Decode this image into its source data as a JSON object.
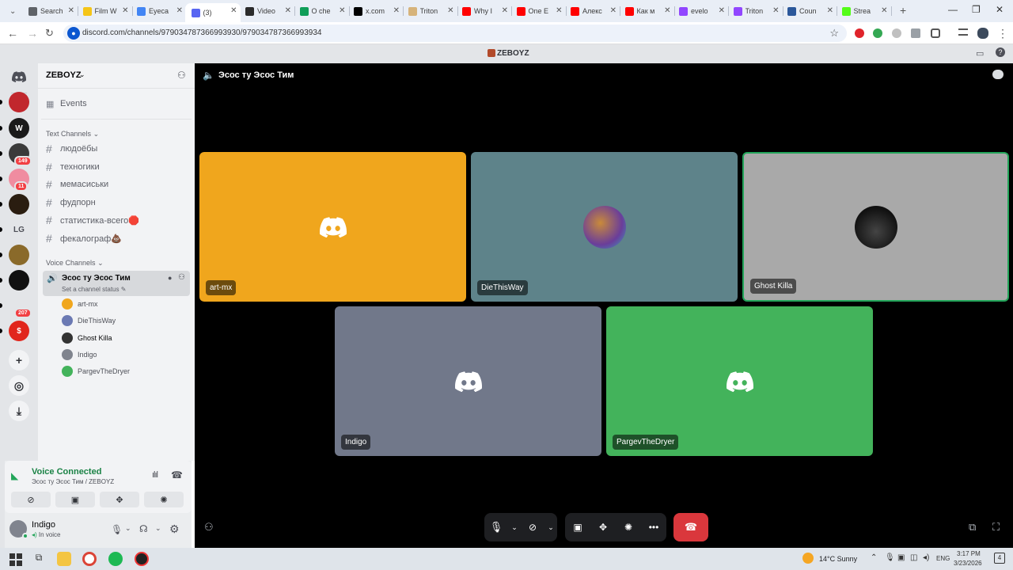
{
  "browser": {
    "tabs": [
      {
        "label": "Search",
        "color": "#5f6368"
      },
      {
        "label": "Film W",
        "color": "#f5c518"
      },
      {
        "label": "Eyeca",
        "color": "#4285f4"
      },
      {
        "label": "(3)",
        "color": "#5865f2",
        "active": true
      },
      {
        "label": "Video",
        "color": "#2b2b2b"
      },
      {
        "label": "O che",
        "color": "#0f9d58"
      },
      {
        "label": "x.com",
        "color": "#000000"
      },
      {
        "label": "Triton",
        "color": "#d6b37a"
      },
      {
        "label": "Why I",
        "color": "#ff0000"
      },
      {
        "label": "One E",
        "color": "#ff0000"
      },
      {
        "label": "Алекс",
        "color": "#ff0000"
      },
      {
        "label": "Как м",
        "color": "#ff0000"
      },
      {
        "label": "evelo",
        "color": "#9146ff"
      },
      {
        "label": "Triton",
        "color": "#9146ff"
      },
      {
        "label": "Coun",
        "color": "#2b579a"
      },
      {
        "label": "Strea",
        "color": "#53fc18"
      }
    ],
    "url": "discord.com/channels/979034787366993930/979034787366993934"
  },
  "titlebar": {
    "server_name": "ZEBOYZ"
  },
  "guilds": {
    "items": [
      {
        "color": "#c1272d",
        "text": ""
      },
      {
        "color": "#1a1a1a",
        "text": "W"
      },
      {
        "color": "#3a3a3a",
        "text": "",
        "badge": "149"
      },
      {
        "color": "#f08ca0",
        "text": "",
        "badge": "11"
      },
      {
        "color": "#2a1d10",
        "text": ""
      },
      {
        "color": "#e3e5e8",
        "text": "LG"
      },
      {
        "color": "#8a6a2a",
        "text": ""
      },
      {
        "color": "#111111",
        "text": ""
      },
      {
        "color": "#e3e5e8",
        "text": "",
        "badge": "207"
      },
      {
        "color": "#e1261c",
        "text": "$"
      }
    ]
  },
  "sidebar": {
    "server_name": "ZEBOYZ",
    "events_label": "Events",
    "text_category": "Text Channels",
    "text_channels": [
      {
        "name": "людоёбы"
      },
      {
        "name": "техногики"
      },
      {
        "name": "мемасиськи"
      },
      {
        "name": "фудпорн"
      },
      {
        "name": "статистика-всего🛑"
      },
      {
        "name": "фекалограф💩"
      }
    ],
    "voice_category": "Voice Channels",
    "voice_channel": {
      "name": "Эсос ту Эсос Тим",
      "status": "Set a channel status"
    },
    "voice_users": [
      {
        "name": "art-mx",
        "color": "#f0a61d"
      },
      {
        "name": "DieThisWay",
        "color": "#6b79b3"
      },
      {
        "name": "Ghost Killa",
        "color": "#333333"
      },
      {
        "name": "Indigo",
        "color": "#80848e"
      },
      {
        "name": "PargevTheDryer",
        "color": "#43b35b"
      }
    ]
  },
  "voice_panel": {
    "status": "Voice Connected",
    "channel": "Эсос ту Эсос Тим / ZEBOYZ"
  },
  "user": {
    "name": "Indigo",
    "status": "In voice"
  },
  "stage": {
    "channel_name": "Эсос ту Эсос Тим",
    "tiles": [
      {
        "name": "art-mx",
        "color": "#f0a61d",
        "type": "logo"
      },
      {
        "name": "DieThisWay",
        "color": "#5e838a",
        "type": "avatar"
      },
      {
        "name": "Ghost Killa",
        "color": "#a9a9a9",
        "type": "avatar"
      },
      {
        "name": "Indigo",
        "color": "#71788a",
        "type": "logo"
      },
      {
        "name": "PargevTheDryer",
        "color": "#43b35b",
        "type": "logo"
      }
    ]
  },
  "taskbar": {
    "weather": "14°C  Sunny",
    "lang": "ENG",
    "time": "3:17 PM",
    "date": "3/23/2026",
    "notif_count": "4"
  }
}
